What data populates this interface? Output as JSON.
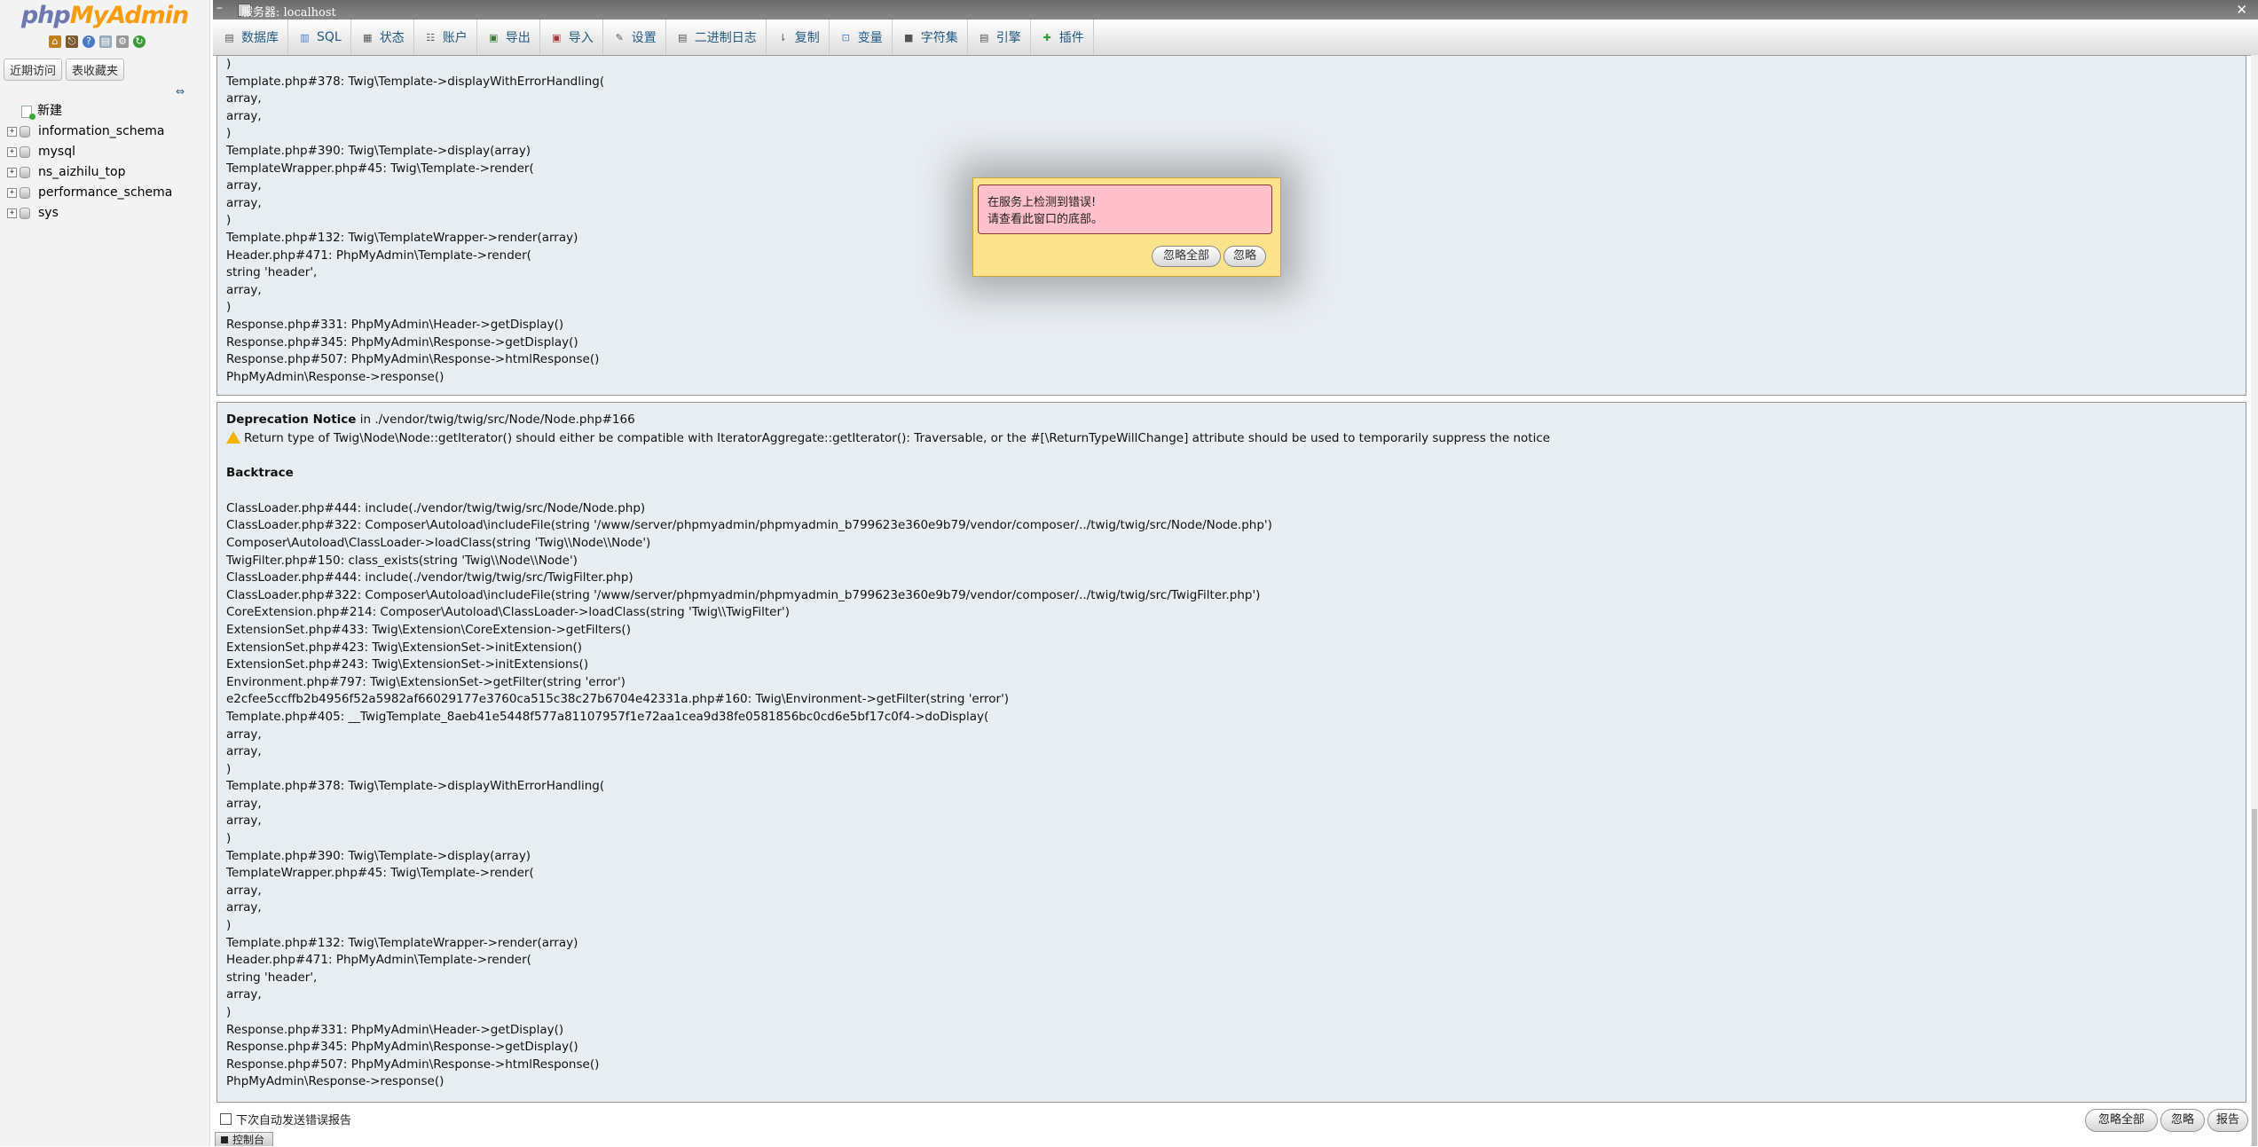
{
  "navigation": {
    "logo_part1": "php",
    "logo_part2": "MyAdmin",
    "tabs": [
      "近期访问",
      "表收藏夹"
    ],
    "collapse_link": "⇔",
    "tree": [
      {
        "label": "新建",
        "type": "new"
      },
      {
        "label": "information_schema",
        "type": "db"
      },
      {
        "label": "mysql",
        "type": "db"
      },
      {
        "label": "ns_aizhilu_top",
        "type": "db"
      },
      {
        "label": "performance_schema",
        "type": "db"
      },
      {
        "label": "sys",
        "type": "db"
      }
    ]
  },
  "server_bar": {
    "label": "服务器:  localhost",
    "menu_toggle": "–",
    "close": "✕"
  },
  "top_menu": [
    {
      "label": "数据库",
      "icon": "database-icon"
    },
    {
      "label": "SQL",
      "icon": "sql-icon"
    },
    {
      "label": "状态",
      "icon": "status-icon"
    },
    {
      "label": "账户",
      "icon": "accounts-icon"
    },
    {
      "label": "导出",
      "icon": "export-icon"
    },
    {
      "label": "导入",
      "icon": "import-icon"
    },
    {
      "label": "设置",
      "icon": "settings-icon"
    },
    {
      "label": "二进制日志",
      "icon": "binlog-icon"
    },
    {
      "label": "复制",
      "icon": "replication-icon"
    },
    {
      "label": "变量",
      "icon": "variables-icon"
    },
    {
      "label": "字符集",
      "icon": "charset-icon"
    },
    {
      "label": "引擎",
      "icon": "engine-icon"
    },
    {
      "label": "插件",
      "icon": "plugin-icon"
    }
  ],
  "panel1": {
    "lines": [
      ")",
      "Template.php#378: Twig\\Template->displayWithErrorHandling(",
      "array,",
      "array,",
      ")",
      "Template.php#390: Twig\\Template->display(array)",
      "TemplateWrapper.php#45: Twig\\Template->render(",
      "array,",
      "array,",
      ")",
      "Template.php#132: Twig\\TemplateWrapper->render(array)",
      "Header.php#471: PhpMyAdmin\\Template->render(",
      "string 'header',",
      "array,",
      ")",
      "Response.php#331: PhpMyAdmin\\Header->getDisplay()",
      "Response.php#345: PhpMyAdmin\\Response->getDisplay()",
      "Response.php#507: PhpMyAdmin\\Response->htmlResponse()",
      "PhpMyAdmin\\Response->response()"
    ]
  },
  "panel2": {
    "notice_type": "Deprecation Notice",
    "notice_in": " in ./vendor/twig/twig/src/Node/Node.php#166",
    "notice_message": "Return type of Twig\\Node\\Node::getIterator() should either be compatible with IteratorAggregate::getIterator(): Traversable, or the #[\\ReturnTypeWillChange] attribute should be used to temporarily suppress the notice",
    "backtrace_heading": "Backtrace",
    "lines": [
      "ClassLoader.php#444: include(./vendor/twig/twig/src/Node/Node.php)",
      "ClassLoader.php#322: Composer\\Autoload\\includeFile(string '/www/server/phpmyadmin/phpmyadmin_b799623e360e9b79/vendor/composer/../twig/twig/src/Node/Node.php')",
      "Composer\\Autoload\\ClassLoader->loadClass(string 'Twig\\\\Node\\\\Node')",
      "TwigFilter.php#150: class_exists(string 'Twig\\\\Node\\\\Node')",
      "ClassLoader.php#444: include(./vendor/twig/twig/src/TwigFilter.php)",
      "ClassLoader.php#322: Composer\\Autoload\\includeFile(string '/www/server/phpmyadmin/phpmyadmin_b799623e360e9b79/vendor/composer/../twig/twig/src/TwigFilter.php')",
      "CoreExtension.php#214: Composer\\Autoload\\ClassLoader->loadClass(string 'Twig\\\\TwigFilter')",
      "ExtensionSet.php#433: Twig\\Extension\\CoreExtension->getFilters()",
      "ExtensionSet.php#423: Twig\\ExtensionSet->initExtension()",
      "ExtensionSet.php#243: Twig\\ExtensionSet->initExtensions()",
      "Environment.php#797: Twig\\ExtensionSet->getFilter(string 'error')",
      "e2cfee5ccffb2b4956f52a5982af66029177e3760ca515c38c27b6704e42331a.php#160: Twig\\Environment->getFilter(string 'error')",
      "Template.php#405: __TwigTemplate_8aeb41e5448f577a81107957f1e72aa1cea9d38fe0581856bc0cd6e5bf17c0f4->doDisplay(",
      "array,",
      "array,",
      ")",
      "Template.php#378: Twig\\Template->displayWithErrorHandling(",
      "array,",
      "array,",
      ")",
      "Template.php#390: Twig\\Template->display(array)",
      "TemplateWrapper.php#45: Twig\\Template->render(",
      "array,",
      "array,",
      ")",
      "Template.php#132: Twig\\TemplateWrapper->render(array)",
      "Header.php#471: PhpMyAdmin\\Template->render(",
      "string 'header',",
      "array,",
      ")",
      "Response.php#331: PhpMyAdmin\\Header->getDisplay()",
      "Response.php#345: PhpMyAdmin\\Response->getDisplay()",
      "Response.php#507: PhpMyAdmin\\Response->htmlResponse()",
      "PhpMyAdmin\\Response->response()"
    ]
  },
  "popup": {
    "line1": "在服务上检测到错误!",
    "line2": "请查看此窗口的底部。",
    "ignore_all": "忽略全部",
    "ignore": "忽略"
  },
  "bottom": {
    "auto_send_label": "下次自动发送错误报告",
    "ignore_all": "忽略全部",
    "ignore": "忽略",
    "report": "报告",
    "console": "控制台"
  },
  "colors": {
    "accent": "#235a81",
    "logo_php": "#6c78af",
    "logo_myadmin": "#f89c0e",
    "error_panel_bg": "#e8edf1",
    "popup_bg": "#fbe38c",
    "popup_msg_bg": "#ffc0cb"
  }
}
